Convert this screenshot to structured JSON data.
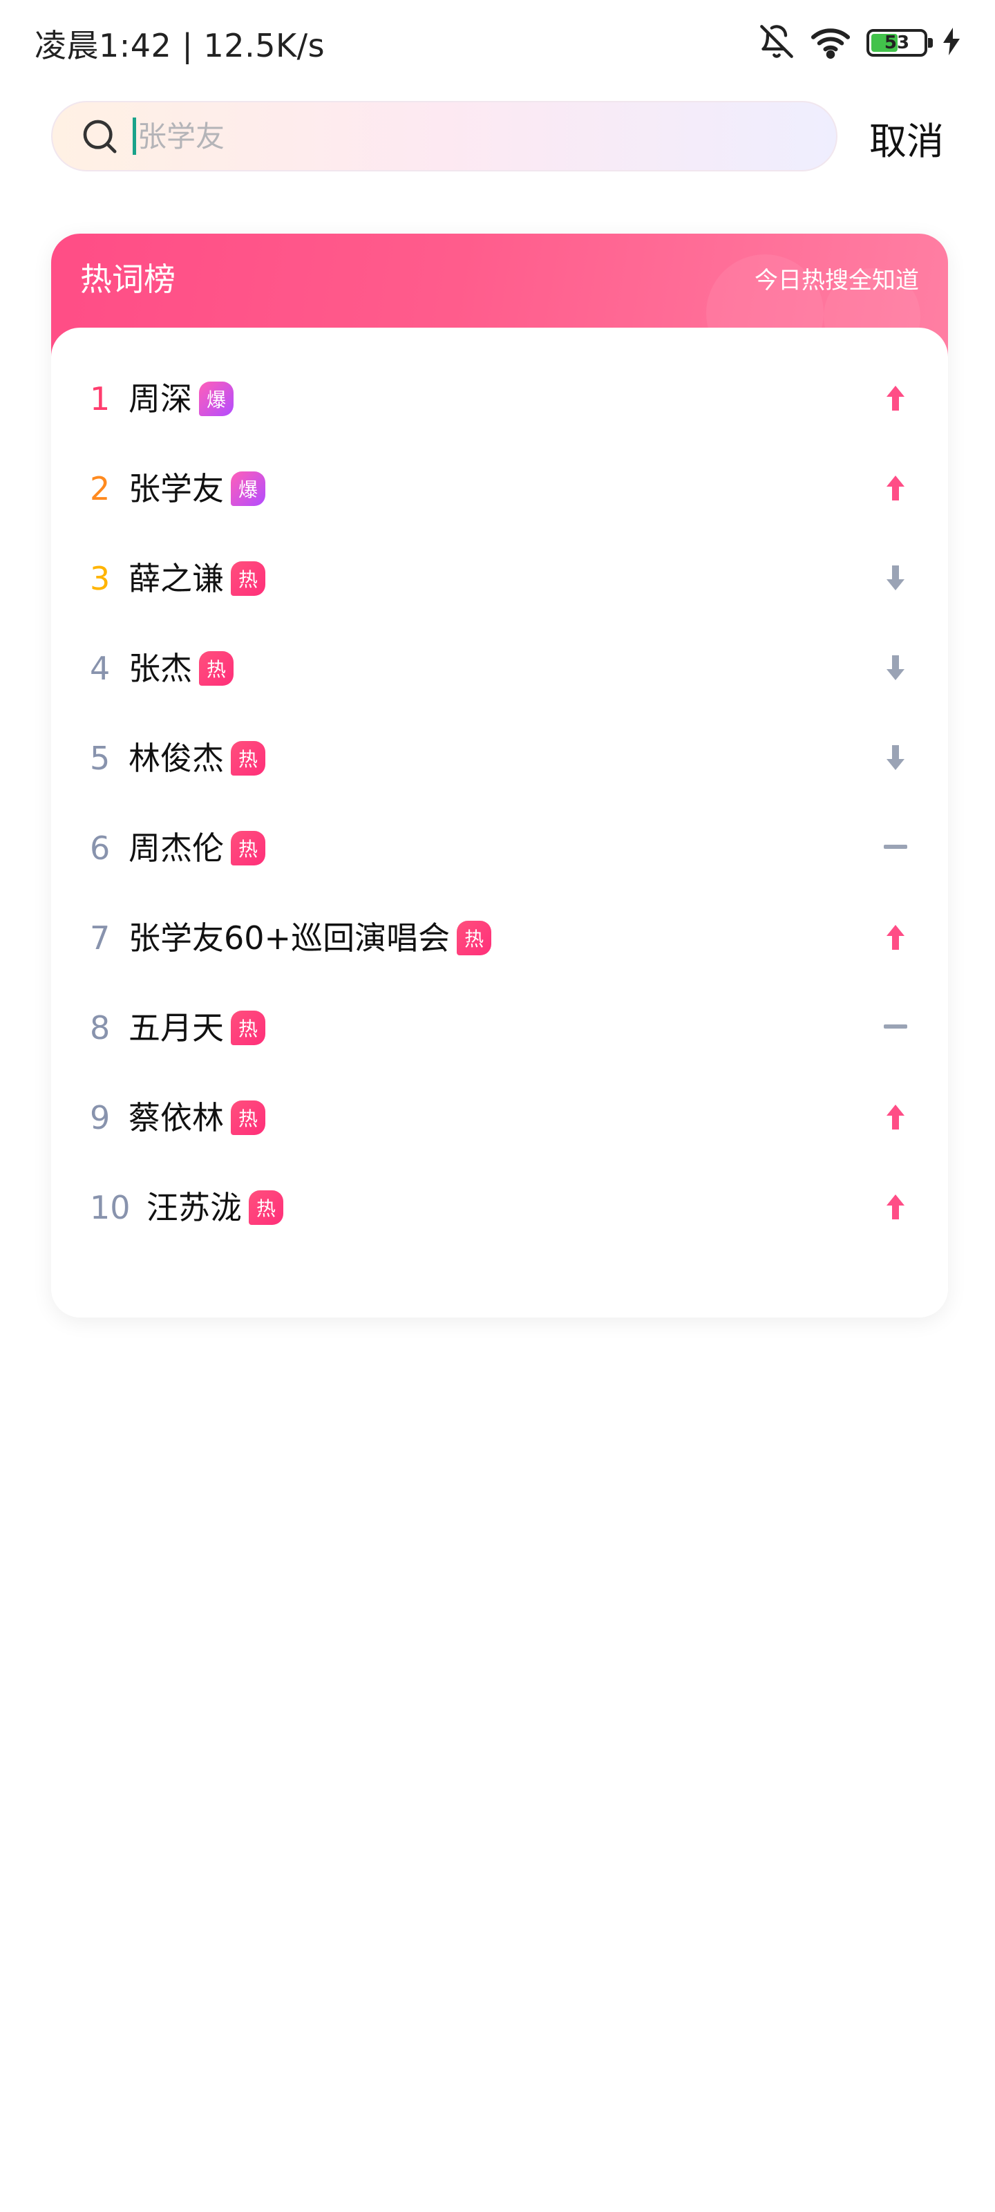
{
  "status_bar": {
    "time": "凌晨1:42 | 12.5K/s",
    "battery": "53",
    "icons": [
      "bell-off-icon",
      "wifi-icon",
      "battery-icon",
      "charging-bolt-icon"
    ]
  },
  "search": {
    "placeholder": "张学友",
    "value": "",
    "cancel_label": "取消"
  },
  "hot_list": {
    "title": "热词榜",
    "subtitle": "今日热搜全知道",
    "colors": {
      "header_accent": "#ff4d86",
      "rank1": "#ff3d6e",
      "rank2": "#ff8a1f",
      "rank3": "#ffb400",
      "rank_other": "#8893ad",
      "trend_up": "#ff4d86",
      "trend_down": "#9aa3b5"
    },
    "items": [
      {
        "rank": "1",
        "term": "周深",
        "tag": "爆",
        "tag_type": "boom",
        "trend": "up"
      },
      {
        "rank": "2",
        "term": "张学友",
        "tag": "爆",
        "tag_type": "boom",
        "trend": "up"
      },
      {
        "rank": "3",
        "term": "薛之谦",
        "tag": "热",
        "tag_type": "hot",
        "trend": "down"
      },
      {
        "rank": "4",
        "term": "张杰",
        "tag": "热",
        "tag_type": "hot",
        "trend": "down"
      },
      {
        "rank": "5",
        "term": "林俊杰",
        "tag": "热",
        "tag_type": "hot",
        "trend": "down"
      },
      {
        "rank": "6",
        "term": "周杰伦",
        "tag": "热",
        "tag_type": "hot",
        "trend": "flat"
      },
      {
        "rank": "7",
        "term": "张学友60+巡回演唱会",
        "tag": "热",
        "tag_type": "hot",
        "trend": "up"
      },
      {
        "rank": "8",
        "term": "五月天",
        "tag": "热",
        "tag_type": "hot",
        "trend": "flat"
      },
      {
        "rank": "9",
        "term": "蔡依林",
        "tag": "热",
        "tag_type": "hot",
        "trend": "up"
      },
      {
        "rank": "10",
        "term": "汪苏泷",
        "tag": "热",
        "tag_type": "hot",
        "trend": "up"
      }
    ]
  }
}
